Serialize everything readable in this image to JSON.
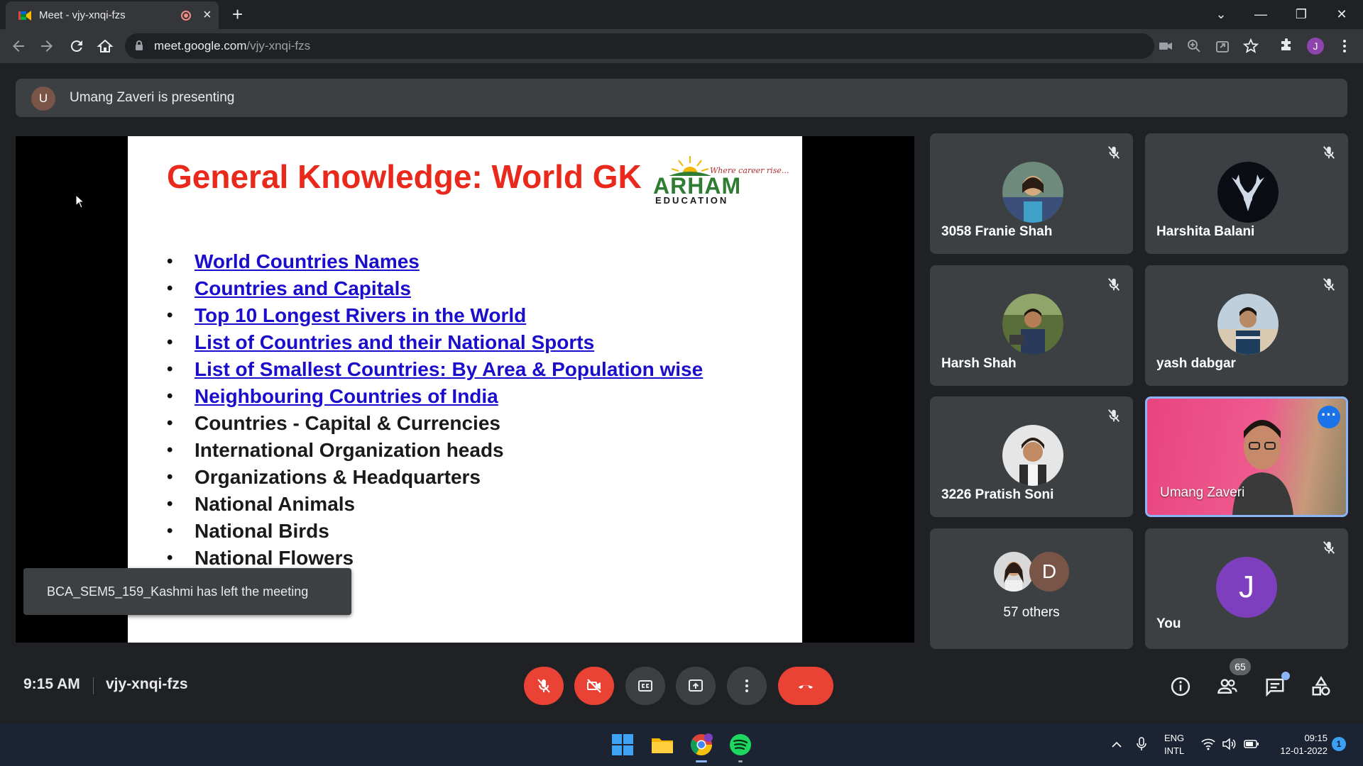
{
  "browser": {
    "tab_title": "Meet - vjy-xnqi-fzs",
    "close_glyph": "×",
    "new_tab_glyph": "+",
    "url_host": "meet.google.com",
    "url_path": "/vjy-xnqi-fzs",
    "profile_initial": "J",
    "window_controls": [
      "⌄",
      "—",
      "❐",
      "✕"
    ]
  },
  "meeting": {
    "presenter_initial": "U",
    "presenting_text": "Umang Zaveri is presenting",
    "time": "9:15 AM",
    "code": "vjy-xnqi-fzs",
    "participant_count": "65",
    "toast": "BCA_SEM5_159_Kashmi has left the meeting"
  },
  "slide": {
    "title": "General Knowledge: World GK",
    "logo": {
      "tagline": "Where career rise...",
      "name": "ARHAM",
      "sub": "EDUCATION"
    },
    "items": [
      {
        "text": "World Countries Names",
        "link": true
      },
      {
        "text": "Countries and Capitals",
        "link": true
      },
      {
        "text": "Top 10 Longest Rivers in the World",
        "link": true
      },
      {
        "text": "List of Countries and their National Sports",
        "link": true
      },
      {
        "text": "List of Smallest Countries: By Area & Population wise",
        "link": true
      },
      {
        "text": "Neighbouring Countries of India",
        "link": true
      },
      {
        "text": "Countries - Capital & Currencies",
        "link": false
      },
      {
        "text": "International Organization heads",
        "link": false
      },
      {
        "text": "Organizations & Headquarters",
        "link": false
      },
      {
        "text": "National Animals",
        "link": false
      },
      {
        "text": "National Birds",
        "link": false
      },
      {
        "text": "National Flowers",
        "link": false
      }
    ]
  },
  "participants": [
    {
      "name": "3058 Franie Shah",
      "muted": true,
      "avatar": "photo"
    },
    {
      "name": "Harshita Balani",
      "muted": true,
      "avatar": "deer-logo"
    },
    {
      "name": "Harsh Shah",
      "muted": true,
      "avatar": "photo"
    },
    {
      "name": "yash dabgar",
      "muted": true,
      "avatar": "photo"
    },
    {
      "name": "3226 Pratish Soni",
      "muted": true,
      "avatar": "photo"
    },
    {
      "name": "Umang Zaveri",
      "muted": false,
      "avatar": "video"
    },
    {
      "name": "57 others",
      "muted": false,
      "avatar_initial": "D"
    },
    {
      "name": "You",
      "muted": true,
      "avatar_initial": "J"
    }
  ],
  "taskbar": {
    "lang_line1": "ENG",
    "lang_line2": "INTL",
    "time": "09:15",
    "date": "12-01-2022",
    "notifications": "1"
  },
  "colors": {
    "meet_bg": "#202124",
    "tile_bg": "#3c4043",
    "danger": "#ea4335",
    "slide_title": "#e8291c",
    "link": "#1a0dcc",
    "accent": "#8ab4f8"
  }
}
